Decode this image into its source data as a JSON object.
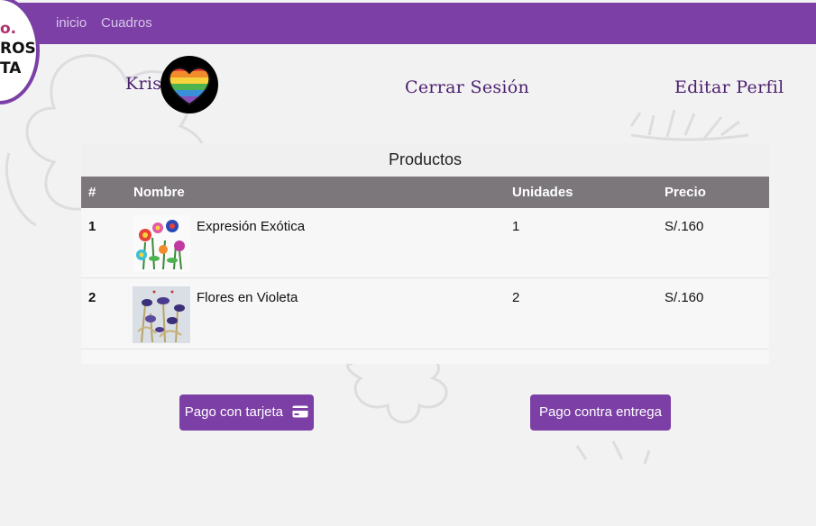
{
  "nav": {
    "links": [
      "inicio",
      "Cuadros"
    ],
    "logo_lines": [
      "o.",
      "ROS",
      "TA"
    ]
  },
  "header": {
    "user_name": "Kris",
    "logout_label": "Cerrar Sesión",
    "edit_profile_label": "Editar Perfil"
  },
  "products": {
    "title": "Productos",
    "columns": [
      "#",
      "Nombre",
      "Unidades",
      "Precio"
    ],
    "rows": [
      {
        "index": "1",
        "name": "Expresión Exótica",
        "units": "1",
        "price": "S/.160",
        "thumb_icon": "flowers-painting-thumbnail"
      },
      {
        "index": "2",
        "name": "Flores en Violeta",
        "units": "2",
        "price": "S/.160",
        "thumb_icon": "violet-flowers-thumbnail"
      }
    ]
  },
  "actions": {
    "card_payment_label": "Pago con tarjeta",
    "card_payment_icon": "credit-card-icon",
    "cash_on_delivery_label": "Pago contra entrega"
  },
  "colors": {
    "brand_purple": "#7b3fa5",
    "table_header": "#7c777b",
    "page_background": "#f3f2f3",
    "handwriting": "#4a1f6e"
  }
}
